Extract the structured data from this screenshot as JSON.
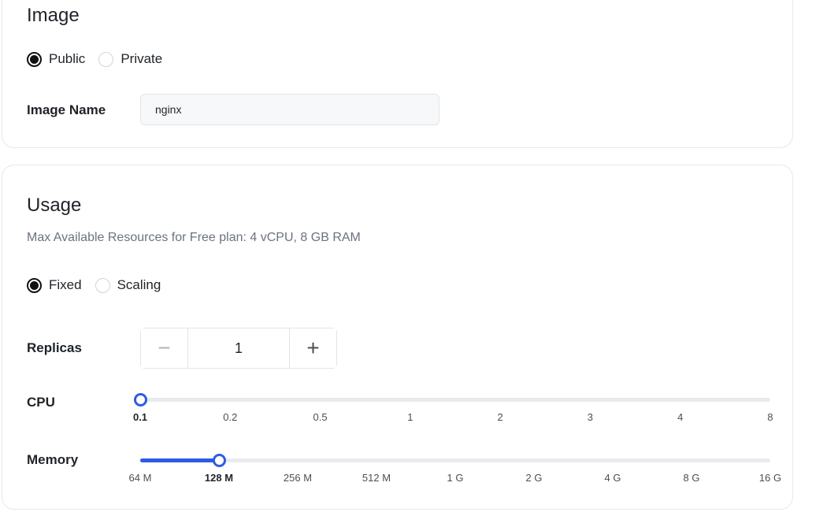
{
  "image_section": {
    "title": "Image",
    "visibility": {
      "options": [
        "Public",
        "Private"
      ],
      "selected": "Public"
    },
    "image_name": {
      "label": "Image Name",
      "value": "nginx"
    }
  },
  "usage_section": {
    "title": "Usage",
    "subtitle": "Max Available Resources for Free plan: 4 vCPU, 8 GB RAM",
    "mode": {
      "options": [
        "Fixed",
        "Scaling"
      ],
      "selected": "Fixed"
    },
    "replicas": {
      "label": "Replicas",
      "value": "1",
      "decrement_symbol": "−",
      "increment_symbol": "+"
    },
    "cpu": {
      "label": "CPU",
      "ticks": [
        "0.1",
        "0.2",
        "0.5",
        "1",
        "2",
        "3",
        "4",
        "8"
      ],
      "selected_index": 0
    },
    "memory": {
      "label": "Memory",
      "ticks": [
        "64 M",
        "128 M",
        "256 M",
        "512 M",
        "1 G",
        "2 G",
        "4 G",
        "8 G",
        "16 G"
      ],
      "selected_index": 1
    }
  },
  "colors": {
    "accent": "#2f5be0",
    "track": "#e8eaee"
  }
}
